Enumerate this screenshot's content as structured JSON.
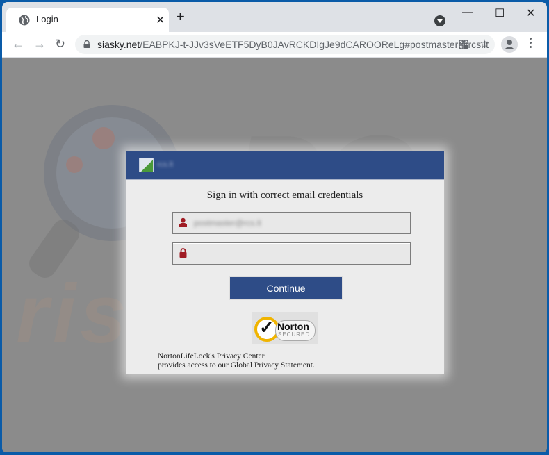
{
  "browser": {
    "tab": {
      "title": "Login",
      "icon": "globe-icon",
      "close_glyph": "✕"
    },
    "new_tab_glyph": "+",
    "window_controls": {
      "minimize": "—",
      "maximize": "☐",
      "close": "✕"
    },
    "nav": {
      "back": "←",
      "forward": "→",
      "reload": "↻"
    },
    "address": {
      "host": "siasky.net",
      "path": "/EABPKJ-t-JJv3sVeETF5DyB0JAvRCKDIgJe9dCAROOReLg#postmaster@rcs.lt"
    },
    "star_glyph": "☆"
  },
  "dialog": {
    "brand_text": "rcs.lt",
    "title": "Sign in with correct email credentials",
    "email_field": {
      "value": "postmaster@rcs.lt",
      "icon": "user-icon"
    },
    "password_field": {
      "value": "",
      "icon": "lock-icon"
    },
    "continue_label": "Continue",
    "badge": {
      "name": "Norton",
      "sub": "SECURED"
    },
    "privacy_line1": "NortonLifeLock's Privacy Center",
    "privacy_line2": "provides access to our Global Privacy Statement.",
    "colors": {
      "header": "#2e4c87",
      "button": "#2e4c87",
      "icon": "#a01c24"
    }
  },
  "watermark": {
    "text": "risk.com"
  }
}
